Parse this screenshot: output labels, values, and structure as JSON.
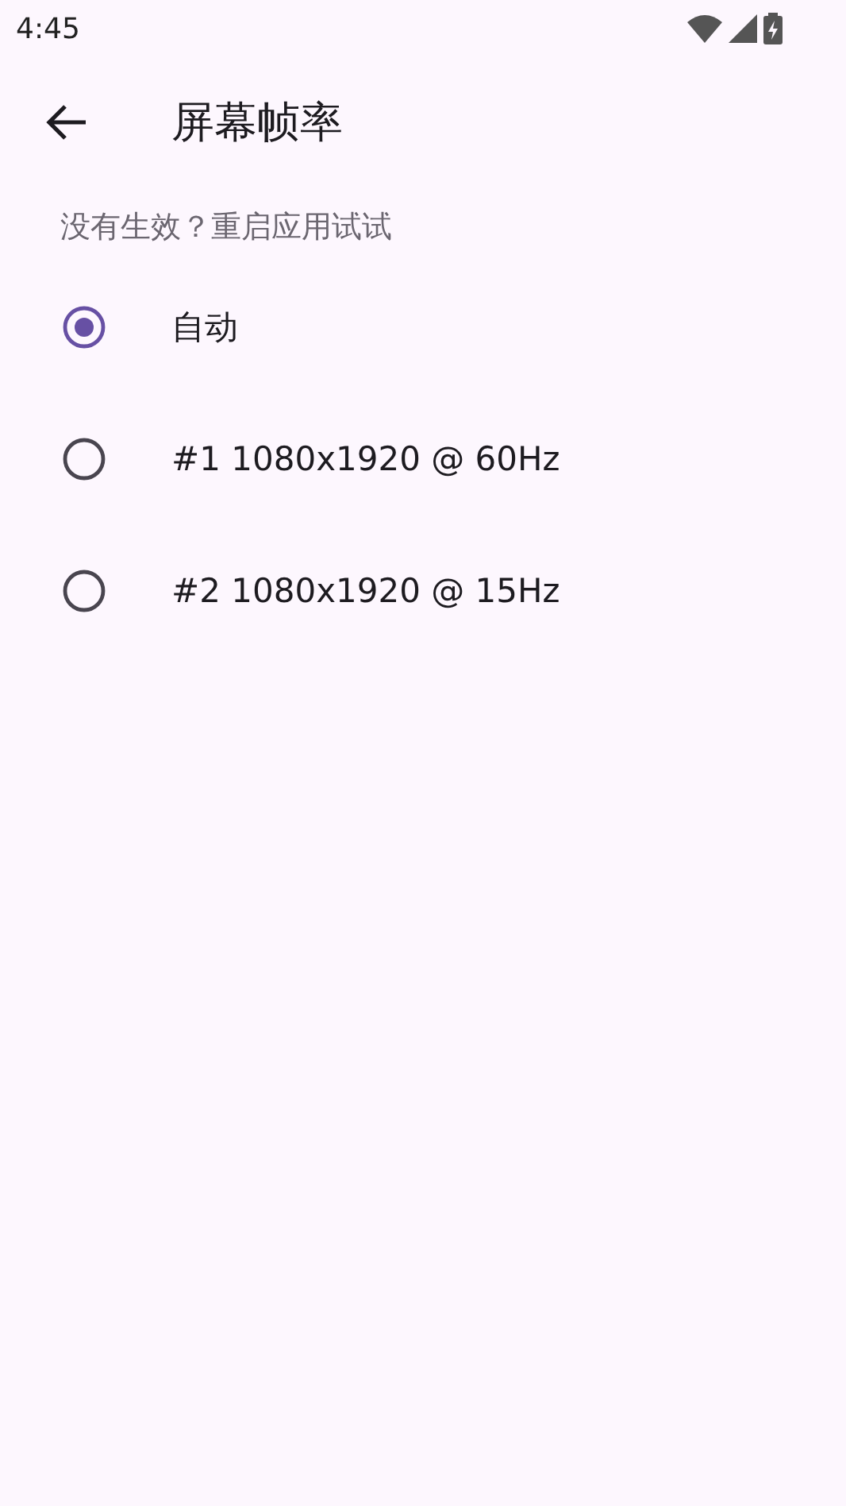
{
  "status_bar": {
    "time": "4:45"
  },
  "app_bar": {
    "title": "屏幕帧率"
  },
  "hint": "没有生效？重启应用试试",
  "options": [
    {
      "label": "自动",
      "selected": true
    },
    {
      "label": "#1 1080x1920 @ 60Hz",
      "selected": false
    },
    {
      "label": "#2 1080x1920 @ 15Hz",
      "selected": false
    }
  ]
}
